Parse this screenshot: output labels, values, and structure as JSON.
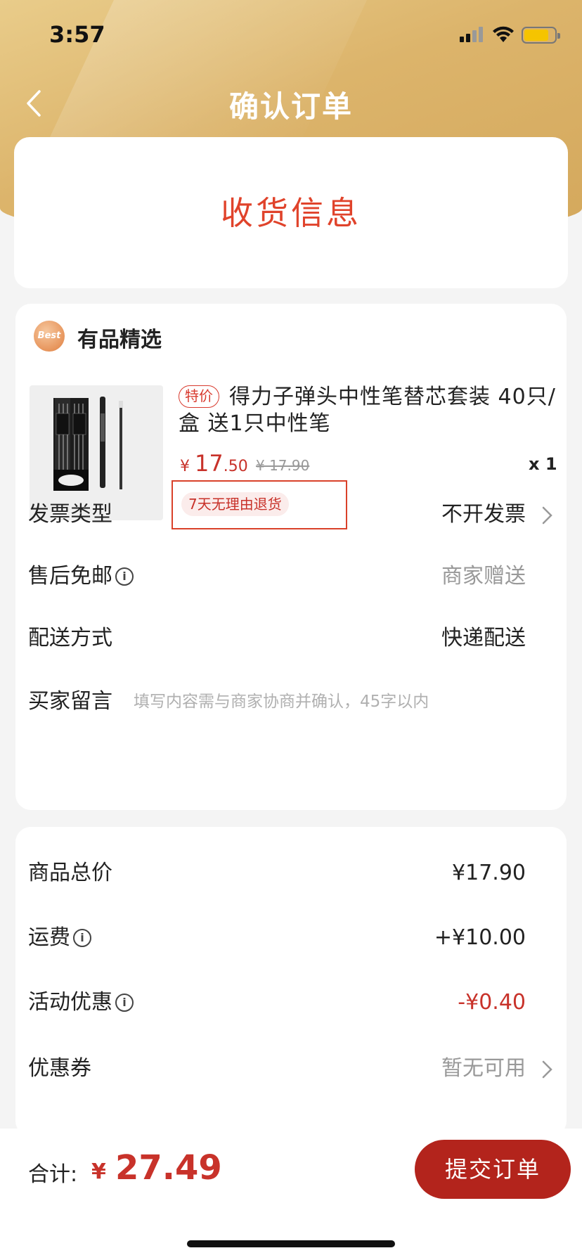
{
  "status": {
    "time": "3:57"
  },
  "nav": {
    "title": "确认订单"
  },
  "address": {
    "placeholder_text": "收货信息"
  },
  "shop": {
    "badge": "Best",
    "name": "有品精选",
    "product": {
      "special_tag": "特价",
      "title": "得力子弹头中性笔替芯套装 40只/盒 送1只中性笔",
      "price_symbol": "¥",
      "price_int": "17",
      "price_dec": ".50",
      "original_price": "¥ 17.90",
      "quantity": "x 1",
      "return_policy": "7天无理由退货"
    }
  },
  "order_options": {
    "invoice": {
      "label": "发票类型",
      "value": "不开发票"
    },
    "aftersale": {
      "label": "售后免邮",
      "value": "商家赠送"
    },
    "delivery": {
      "label": "配送方式",
      "value": "快递配送"
    },
    "note": {
      "label": "买家留言",
      "placeholder": "填写内容需与商家协商并确认，45字以内"
    }
  },
  "pricing": {
    "goods_total": {
      "label": "商品总价",
      "value": "¥17.90"
    },
    "shipping": {
      "label": "运费",
      "value": "+¥10.00"
    },
    "discount": {
      "label": "活动优惠",
      "value": "-¥0.40"
    },
    "coupon": {
      "label": "优惠券",
      "value": "暂无可用"
    }
  },
  "footer": {
    "total_label": "合计:",
    "currency": "¥",
    "total_value": "27.49",
    "submit_label": "提交订单"
  },
  "colors": {
    "accent_red": "#c8322a",
    "header_gold": "#dcb46b",
    "submit_button": "#b3241c"
  }
}
